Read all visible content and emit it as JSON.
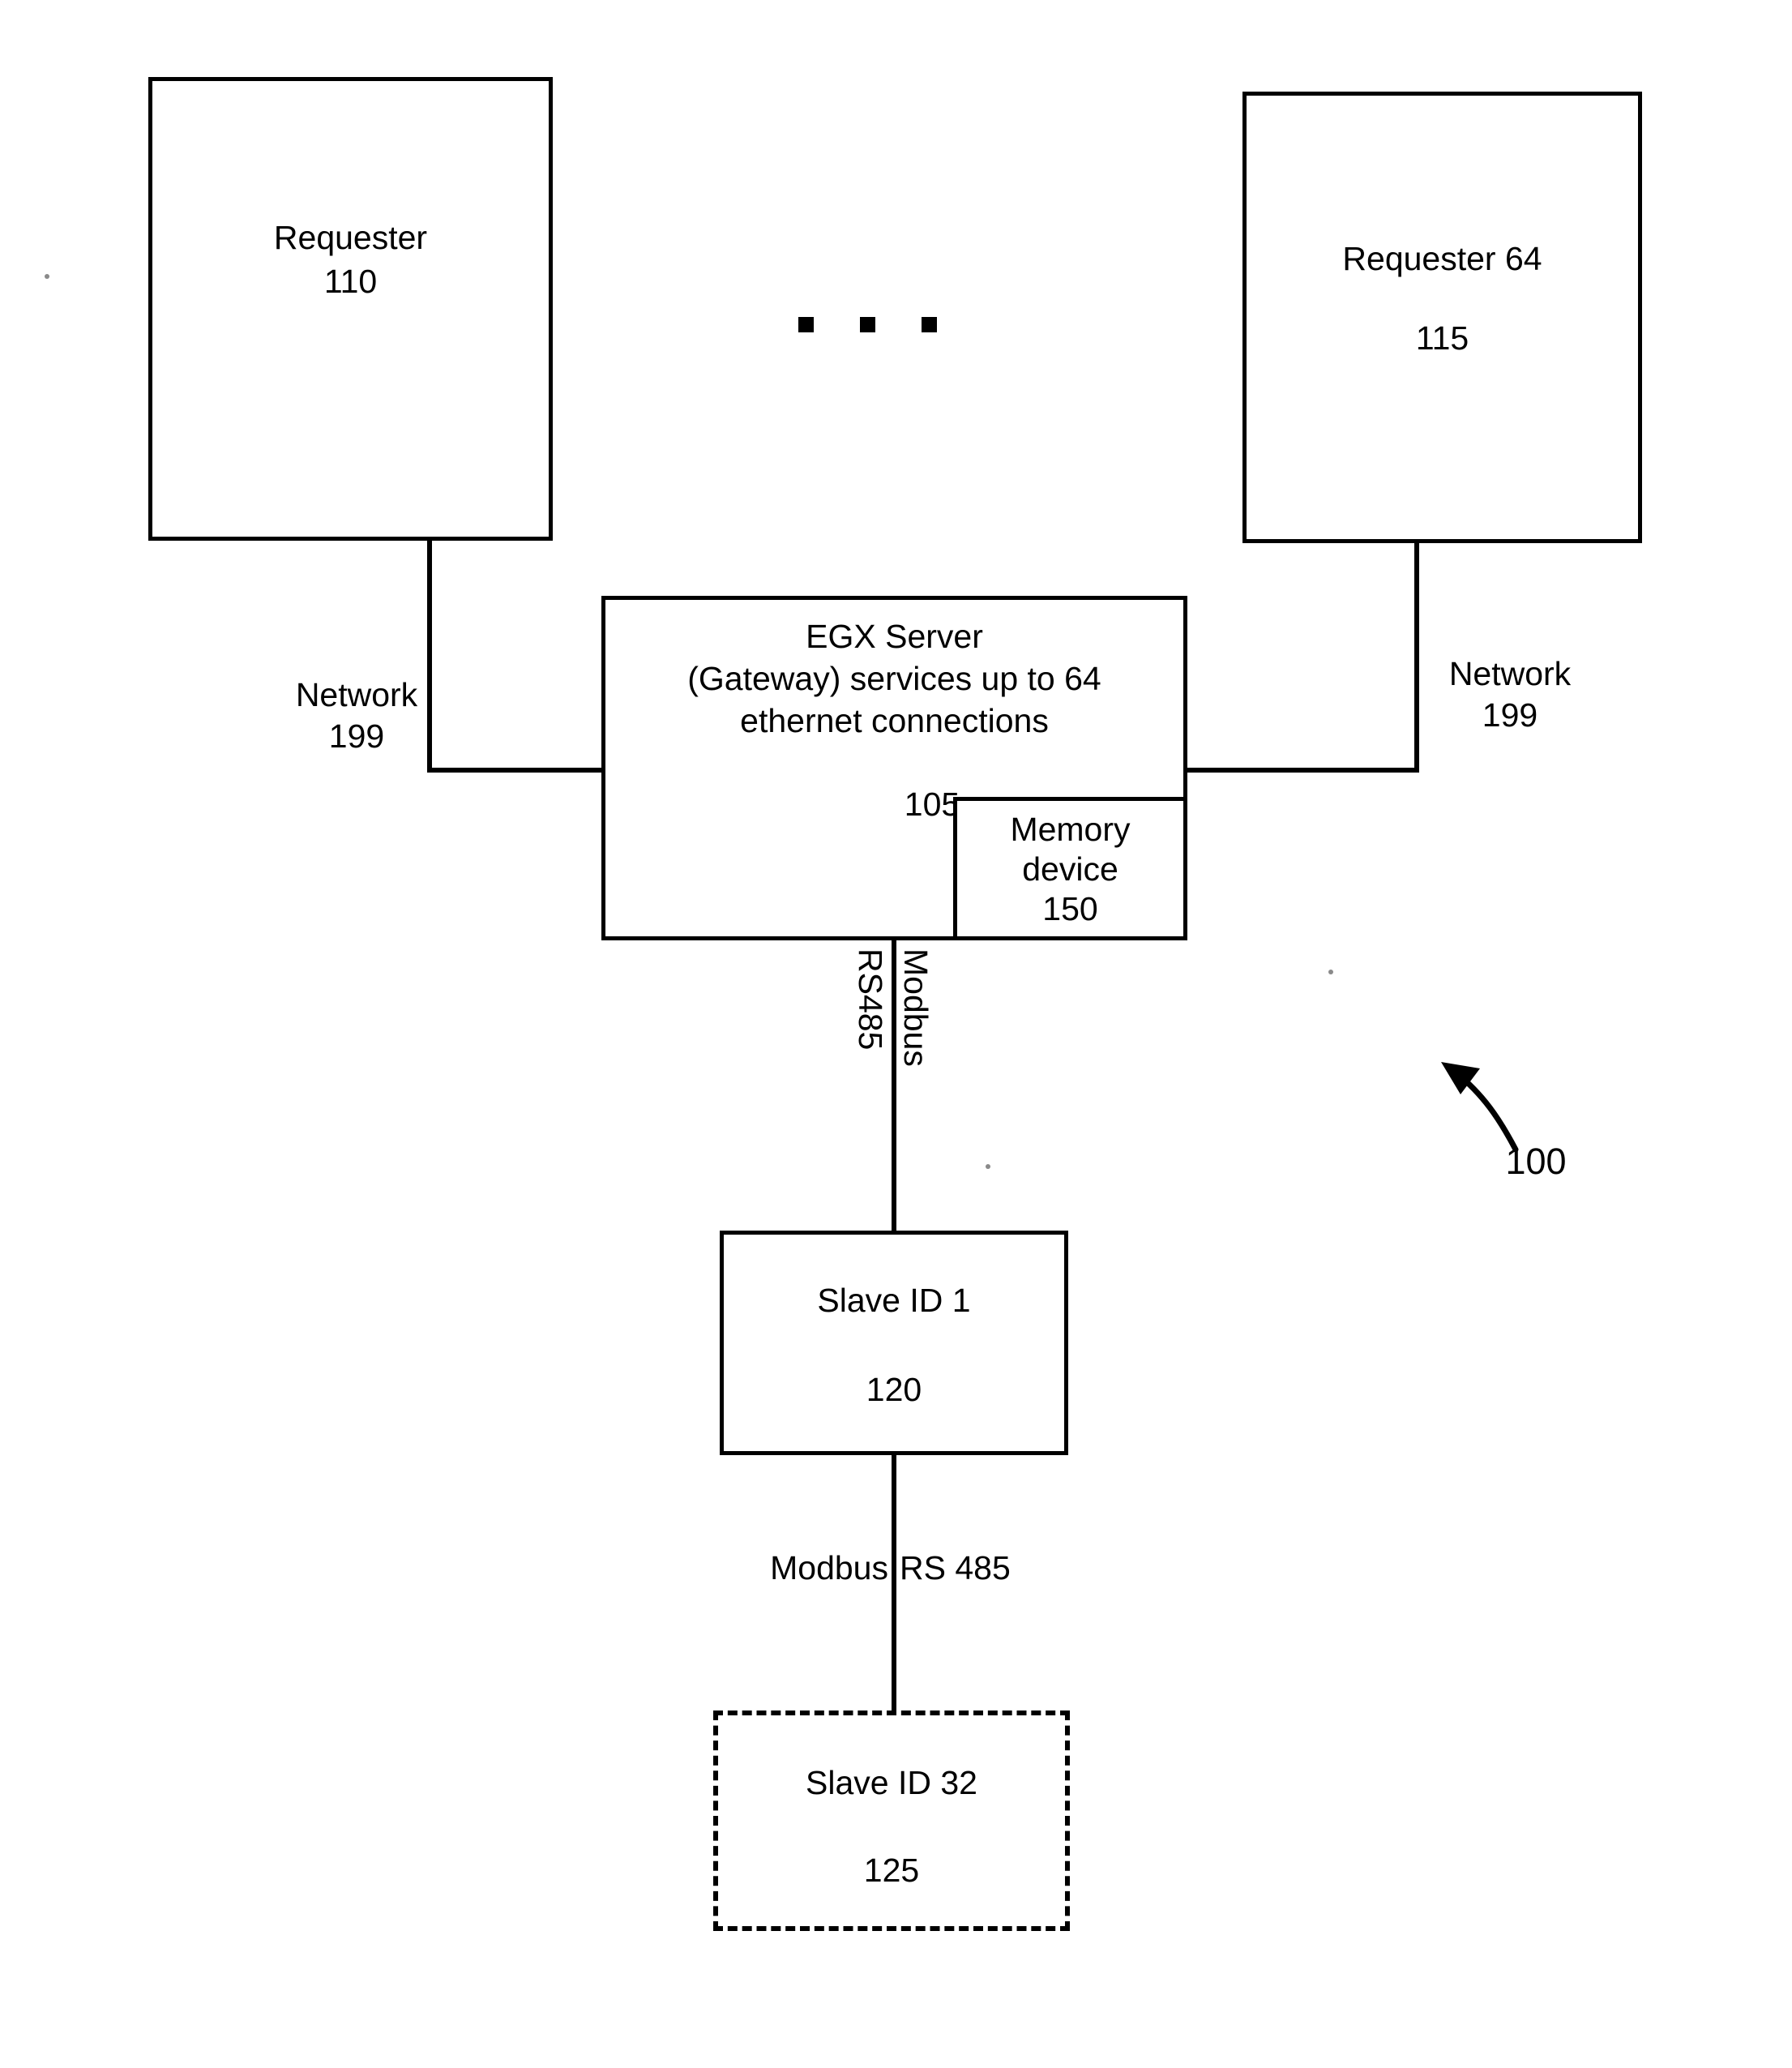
{
  "figure": {
    "reference_numeral": "100",
    "arrow_icon": "curved-arrow-up-left-icon"
  },
  "nodes": {
    "requester_left": {
      "title": "Requester",
      "ref": "110"
    },
    "requester_right": {
      "title": "Requester 64",
      "ref": "115"
    },
    "egx_server": {
      "line1": "EGX Server",
      "line2": "(Gateway) services up to 64",
      "line3": "ethernet connections",
      "ref": "105"
    },
    "memory_device": {
      "line1": "Memory",
      "line2": "device",
      "ref": "150"
    },
    "slave_1": {
      "title": "Slave ID 1",
      "ref": "120"
    },
    "slave_32": {
      "title": "Slave ID 32",
      "ref": "125"
    }
  },
  "connections": {
    "network_left": {
      "name": "Network",
      "ref": "199"
    },
    "network_right": {
      "name": "Network",
      "ref": "199"
    },
    "serial_vertical_left": "RS485",
    "serial_vertical_right": "Modbus",
    "serial_lower_left": "Modbus",
    "serial_lower_right": "RS 485"
  },
  "ellipsis": {
    "label": "horizontal-ellipsis-icon",
    "count": 3
  },
  "colors": {
    "stroke": "#000000",
    "background": "#ffffff"
  }
}
